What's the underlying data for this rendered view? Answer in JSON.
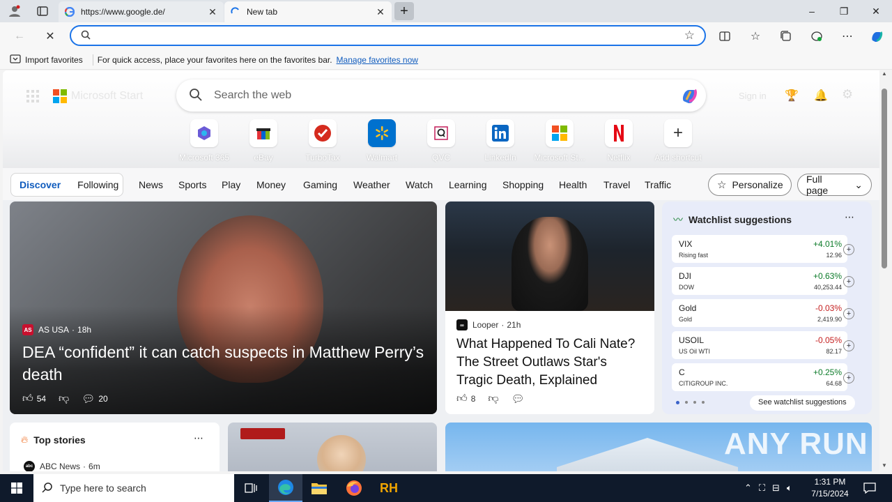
{
  "browser": {
    "tabs": [
      {
        "title": "https://www.google.de/",
        "active": false
      },
      {
        "title": "New tab",
        "active": true
      }
    ],
    "new_tab_symbol": "+",
    "window_controls": {
      "minimize": "–",
      "maximize": "❐",
      "close": "✕"
    },
    "address_placeholder": "",
    "favorites_bar": {
      "import_label": "Import favorites",
      "hint": "For quick access, place your favorites here on the favorites bar.",
      "manage_link": "Manage favorites now"
    }
  },
  "start": {
    "brand": "Microsoft Start",
    "search_placeholder": "Search the web",
    "signin": "Sign in",
    "shortcuts": [
      {
        "label": "Microsoft 365",
        "icon": "m365-icon"
      },
      {
        "label": "eBay",
        "icon": "ebay-icon"
      },
      {
        "label": "TurboTax",
        "icon": "turbotax-icon"
      },
      {
        "label": "Walmart",
        "icon": "walmart-icon"
      },
      {
        "label": "QVC",
        "icon": "qvc-icon"
      },
      {
        "label": "LinkedIn",
        "icon": "linkedin-icon"
      },
      {
        "label": "Microsoft St...",
        "icon": "microsoft-store-icon"
      },
      {
        "label": "Netflix",
        "icon": "netflix-icon"
      },
      {
        "label": "Add shortcut",
        "icon": "plus-icon"
      }
    ],
    "feed_tabs": [
      "Discover",
      "Following"
    ],
    "categories": [
      "News",
      "Sports",
      "Play",
      "Money",
      "Gaming",
      "Weather",
      "Watch",
      "Learning",
      "Shopping",
      "Health",
      "Travel",
      "Traffic"
    ],
    "personalize": "Personalize",
    "layout": "Full page"
  },
  "main_story": {
    "source": "AS USA",
    "age": "18h",
    "headline": "DEA “confident” it can catch suspects in Matthew Perry’s death",
    "likes": "54",
    "comments": "20"
  },
  "second_story": {
    "source": "Looper",
    "age": "21h",
    "headline": "What Happened To Cali Nate? The Street Outlaws Star's Tragic Death, Explained",
    "likes": "8"
  },
  "watchlist": {
    "title": "Watchlist suggestions",
    "items": [
      {
        "symbol": "VIX",
        "name": "Rising fast",
        "change": "+4.01%",
        "price": "12.96",
        "dir": "up"
      },
      {
        "symbol": "DJI",
        "name": "DOW",
        "change": "+0.63%",
        "price": "40,253.44",
        "dir": "up"
      },
      {
        "symbol": "Gold",
        "name": "Gold",
        "change": "-0.03%",
        "price": "2,419.90",
        "dir": "down"
      },
      {
        "symbol": "USOIL",
        "name": "US Oil WTI",
        "change": "-0.05%",
        "price": "82.17",
        "dir": "down"
      },
      {
        "symbol": "C",
        "name": "CITIGROUP INC.",
        "change": "+0.25%",
        "price": "64.68",
        "dir": "up"
      }
    ],
    "see_more": "See watchlist suggestions"
  },
  "top_stories": {
    "title": "Top stories",
    "first_source": "ABC News",
    "first_age": "6m"
  },
  "watermark": "ANY RUN",
  "taskbar": {
    "search_placeholder": "Type here to search",
    "time": "1:31 PM",
    "date": "7/15/2024"
  },
  "colors": {
    "accent": "#0f5bbd",
    "up": "#0b7a28",
    "down": "#c41e1e",
    "taskbar": "#0f1a2b"
  }
}
